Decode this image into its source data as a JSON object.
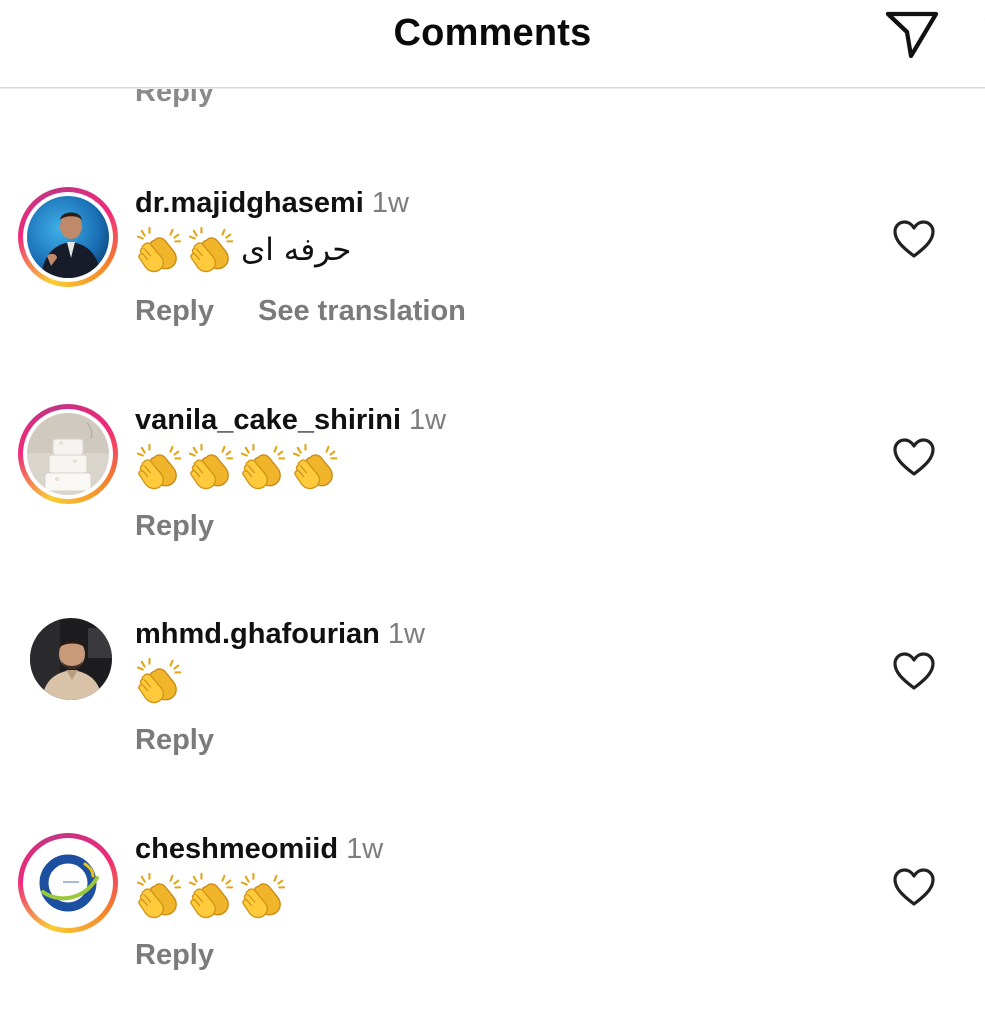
{
  "header": {
    "title": "Comments",
    "share_icon": "paper-plane-icon"
  },
  "previous_comment": {
    "reply_label": "Reply"
  },
  "colors": {
    "muted_text": "#7b7b7b",
    "story_ring": [
      "#f9ce34",
      "#ee2a7b",
      "#c13584"
    ]
  },
  "comments": [
    {
      "username": "dr.majidghasemi",
      "time": "1w",
      "emoji": "clapping-hands",
      "emoji_count": 2,
      "text": "حرفه ای",
      "has_story_ring": true,
      "reply_label": "Reply",
      "translate_label": "See translation",
      "like_icon": "heart-outline-icon"
    },
    {
      "username": "vanila_cake_shirini",
      "time": "1w",
      "emoji": "clapping-hands",
      "emoji_count": 4,
      "text": "",
      "has_story_ring": true,
      "reply_label": "Reply",
      "like_icon": "heart-outline-icon"
    },
    {
      "username": "mhmd.ghafourian",
      "time": "1w",
      "emoji": "clapping-hands",
      "emoji_count": 1,
      "text": "",
      "has_story_ring": false,
      "reply_label": "Reply",
      "like_icon": "heart-outline-icon"
    },
    {
      "username": "cheshmeomiid",
      "time": "1w",
      "emoji": "clapping-hands",
      "emoji_count": 3,
      "text": "",
      "has_story_ring": true,
      "reply_label": "Reply",
      "like_icon": "heart-outline-icon"
    }
  ]
}
